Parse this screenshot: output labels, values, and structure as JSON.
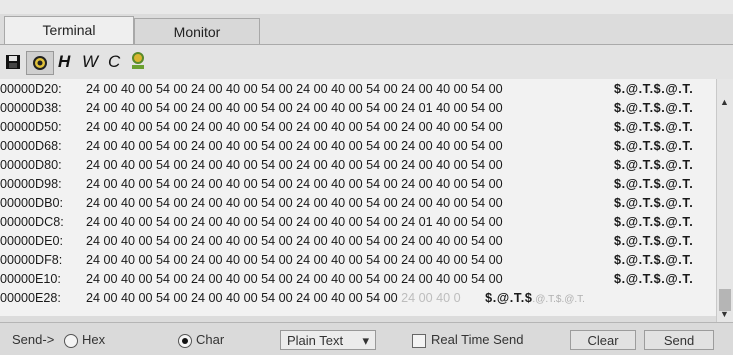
{
  "tabs": [
    {
      "label": "Terminal"
    },
    {
      "label": "Monitor"
    }
  ],
  "toolbar": {
    "save_icon": "floppy-disk-icon",
    "settings_icon": "gear-icon",
    "h_label": "H",
    "w_label": "W",
    "c_label": "C",
    "connect_icon": "connect-icon"
  },
  "terminal": {
    "rows": [
      {
        "addr": "00000D20:",
        "hex": "24 00 40 00 54 00 24 00 40 00 54 00 24 00 40 00 54 00 24 00 40 00 54 00",
        "ascii": "$.@.T.$.@.T."
      },
      {
        "addr": "00000D38:",
        "hex": "24 00 40 00 54 00 24 00 40 00 54 00 24 00 40 00 54 00 24 01 40 00 54 00",
        "ascii": "$.@.T.$.@.T."
      },
      {
        "addr": "00000D50:",
        "hex": "24 00 40 00 54 00 24 00 40 00 54 00 24 00 40 00 54 00 24 00 40 00 54 00",
        "ascii": "$.@.T.$.@.T."
      },
      {
        "addr": "00000D68:",
        "hex": "24 00 40 00 54 00 24 00 40 00 54 00 24 00 40 00 54 00 24 00 40 00 54 00",
        "ascii": "$.@.T.$.@.T."
      },
      {
        "addr": "00000D80:",
        "hex": "24 00 40 00 54 00 24 00 40 00 54 00 24 00 40 00 54 00 24 00 40 00 54 00",
        "ascii": "$.@.T.$.@.T."
      },
      {
        "addr": "00000D98:",
        "hex": "24 00 40 00 54 00 24 00 40 00 54 00 24 00 40 00 54 00 24 00 40 00 54 00",
        "ascii": "$.@.T.$.@.T."
      },
      {
        "addr": "00000DB0:",
        "hex": "24 00 40 00 54 00 24 00 40 00 54 00 24 00 40 00 54 00 24 00 40 00 54 00",
        "ascii": "$.@.T.$.@.T."
      },
      {
        "addr": "00000DC8:",
        "hex": "24 00 40 00 54 00 24 00 40 00 54 00 24 00 40 00 54 00 24 01 40 00 54 00",
        "ascii": "$.@.T.$.@.T."
      },
      {
        "addr": "00000DE0:",
        "hex": "24 00 40 00 54 00 24 00 40 00 54 00 24 00 40 00 54 00 24 00 40 00 54 00",
        "ascii": "$.@.T.$.@.T."
      },
      {
        "addr": "00000DF8:",
        "hex": "24 00 40 00 54 00 24 00 40 00 54 00 24 00 40 00 54 00 24 00 40 00 54 00",
        "ascii": "$.@.T.$.@.T."
      },
      {
        "addr": "00000E10:",
        "hex": "24 00 40 00 54 00 24 00 40 00 54 00 24 00 40 00 54 00 24 00 40 00 54 00",
        "ascii": "$.@.T.$.@.T."
      },
      {
        "addr": "00000E28:",
        "hex": "24 00 40 00 54 00 24 00 40 00 54 00 24 00 40 00 54 00",
        "hex_faded": "24 00 40 0",
        "ascii": "$.@.T.$",
        "ascii_faded": ".@.T.$.@.T."
      }
    ]
  },
  "bottom": {
    "send_label": "Send->",
    "hex_label": "Hex",
    "char_label": "Char",
    "format_value": "Plain Text",
    "realtime_label": "Real Time Send",
    "clear_label": "Clear",
    "send_button_label": "Send"
  }
}
